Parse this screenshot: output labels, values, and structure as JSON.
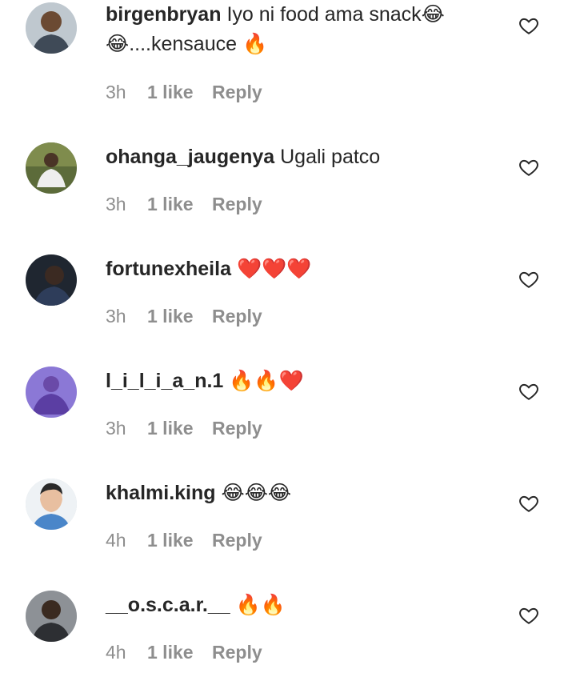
{
  "comments": [
    {
      "username": "birgenbryan",
      "text_line1": "Iyo ni food ama snack😂",
      "text_line2": "😂....kensauce 🔥",
      "time": "3h",
      "likes": "1 like",
      "reply": "Reply",
      "avatar_color": "#7a6a58"
    },
    {
      "username": "ohanga_jaugenya",
      "text_line1": "Ugali patco",
      "text_line2": "",
      "time": "3h",
      "likes": "1 like",
      "reply": "Reply",
      "avatar_color": "#5c6b3a"
    },
    {
      "username": "fortunexheila",
      "text_line1": "❤️❤️❤️",
      "text_line2": "",
      "time": "3h",
      "likes": "1 like",
      "reply": "Reply",
      "avatar_color": "#1f2630"
    },
    {
      "username": "l_i_l_i_a_n.1",
      "text_line1": "🔥🔥❤️",
      "text_line2": "",
      "time": "3h",
      "likes": "1 like",
      "reply": "Reply",
      "avatar_color": "#7d5ec7"
    },
    {
      "username": "khalmi.king",
      "text_line1": "😂😂😂",
      "text_line2": "",
      "time": "4h",
      "likes": "1 like",
      "reply": "Reply",
      "avatar_color": "#e9eef2"
    },
    {
      "username": "__o.s.c.a.r.__",
      "text_line1": "🔥🔥",
      "text_line2": "",
      "time": "4h",
      "likes": "1 like",
      "reply": "Reply",
      "avatar_color": "#6c6f73"
    }
  ],
  "colors": {
    "text": "#262626",
    "meta": "#8e8e8e",
    "heart": "#262626",
    "background": "#ffffff"
  }
}
